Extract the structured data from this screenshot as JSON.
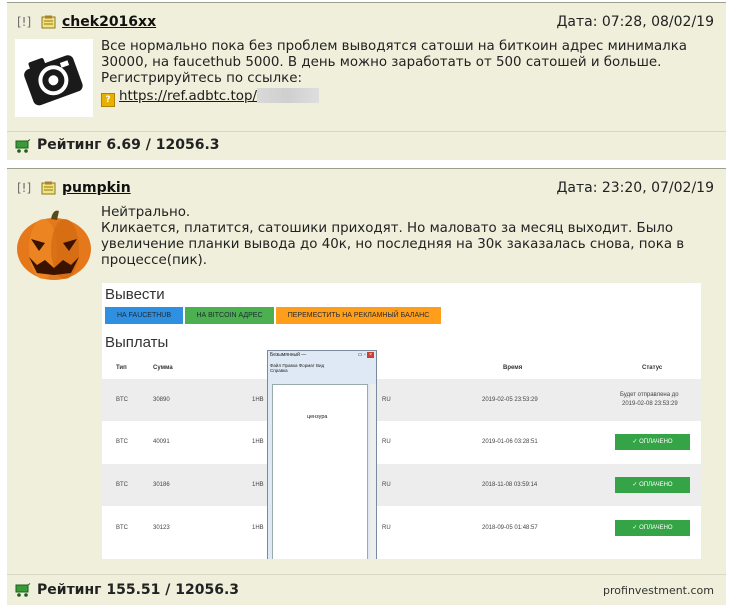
{
  "posts": [
    {
      "marker": "[!]",
      "username": "chek2016xx",
      "date": "Дата: 07:28, 08/02/19",
      "avatar": "camera-avatar",
      "lines": [
        "Все нормально пока без проблем выводятся сатоши на биткоин адрес минималка",
        "30000, на faucethub 5000. В день можно заработать от 500 сатошей и больше.",
        "Регистрируйтесь по ссылке:"
      ],
      "link": "https://ref.adbtc.top/",
      "rating": "Рейтинг 6.69 / 12056.3"
    },
    {
      "marker": "[!]",
      "username": "pumpkin",
      "date": "Дата: 23:20, 07/02/19",
      "avatar": "pumpkin-avatar",
      "lines": [
        "Нейтрально.",
        "Кликается, платится, сатошики приходят. Но маловато за месяц выходит. Было",
        "увеличение планки вывода до 40к, но последняя на 30к заказалась снова, пока в",
        "процессе(пик)."
      ],
      "rating": "Рейтинг 155.51 / 12056.3"
    }
  ],
  "screenshot": {
    "withdraw_title": "Вывести",
    "buttons": [
      {
        "label": "НА FAUCETHUB",
        "color": "#2f8fe0"
      },
      {
        "label": "НА BITCOIN АДРЕС",
        "color": "#4caf50"
      },
      {
        "label": "ПЕРЕМЕСТИТЬ НА РЕКЛАМНЫЙ БАЛАНС",
        "color": "#ff9e1b"
      }
    ],
    "payouts_title": "Выплаты",
    "headers": {
      "type": "Тип",
      "amount": "Сумма",
      "time": "Время",
      "status": "Статус"
    },
    "rows": [
      {
        "type": "BTC",
        "amount": "30890",
        "addr": "1HB",
        "cc": "RU",
        "time": "2019-02-05 23:53:29",
        "status_line1": "Будет отправлена до",
        "status_line2": "2019-02-08 23:53:29"
      },
      {
        "type": "BTC",
        "amount": "40091",
        "addr": "1HB",
        "cc": "RU",
        "time": "2019-01-06 03:28:51",
        "status": "✓ ОПЛАЧЕНО"
      },
      {
        "type": "BTC",
        "amount": "30186",
        "addr": "1HB",
        "cc": "RU",
        "time": "2018-11-08 03:59:14",
        "status": "✓ ОПЛАЧЕНО"
      },
      {
        "type": "BTC",
        "amount": "30123",
        "addr": "1HB",
        "cc": "RU",
        "time": "2018-09-05 01:48:57",
        "status": "✓ ОПЛАЧЕНО"
      }
    ],
    "notepad": {
      "title": "Безымянный —",
      "menu": "Файл  Правка  Формат  Вид",
      "menu2": "Справка",
      "text": "цензура"
    }
  },
  "watermark": "profinvestment.com"
}
